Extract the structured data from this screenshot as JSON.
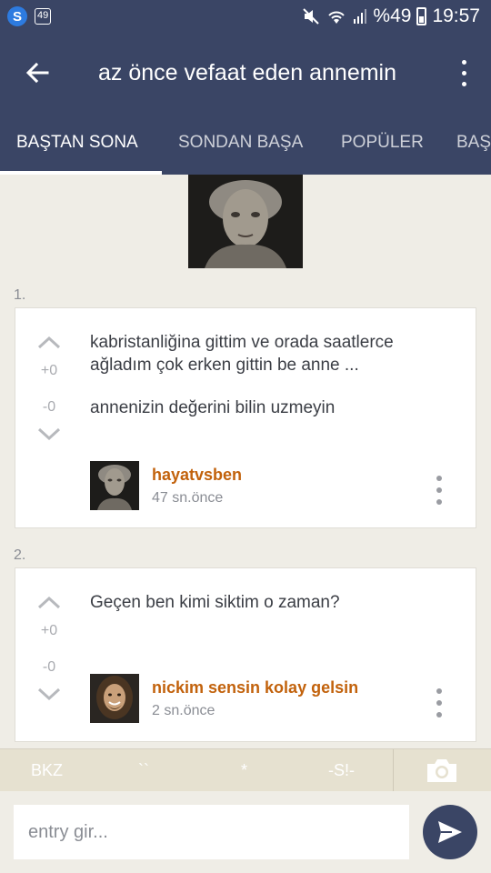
{
  "status_bar": {
    "app_badge": "49",
    "battery": "%49",
    "time": "19:57"
  },
  "app_bar": {
    "title": "az önce vefaat eden annemin",
    "tabs": [
      {
        "label": "BAŞTAN SONA",
        "active": true
      },
      {
        "label": "SONDAN BAŞA",
        "active": false
      },
      {
        "label": "POPÜLER",
        "active": false
      },
      {
        "label": "BAŞ",
        "active": false
      }
    ]
  },
  "entries": [
    {
      "number": "1.",
      "paragraphs": [
        "kabristanliğina gittim ve orada saatlerce ağladım çok erken gittin be anne ...",
        "annenizin değerini bilin uzmeyin"
      ],
      "upvotes": "+0",
      "downvotes": "-0",
      "author": "hayatvsben",
      "time": "47 sn.önce"
    },
    {
      "number": "2.",
      "paragraphs": [
        "Geçen ben kimi siktim o zaman?"
      ],
      "upvotes": "+0",
      "downvotes": "-0",
      "author": "nickim sensin kolay gelsin",
      "time": "2 sn.önce"
    }
  ],
  "format_bar": {
    "bkz": "BKZ",
    "backtick": "``",
    "star": "*",
    "spoiler": "-S!-"
  },
  "input": {
    "placeholder": "entry gir..."
  },
  "colors": {
    "primary": "#3a4565",
    "author": "#c2620c",
    "background": "#efede6"
  }
}
